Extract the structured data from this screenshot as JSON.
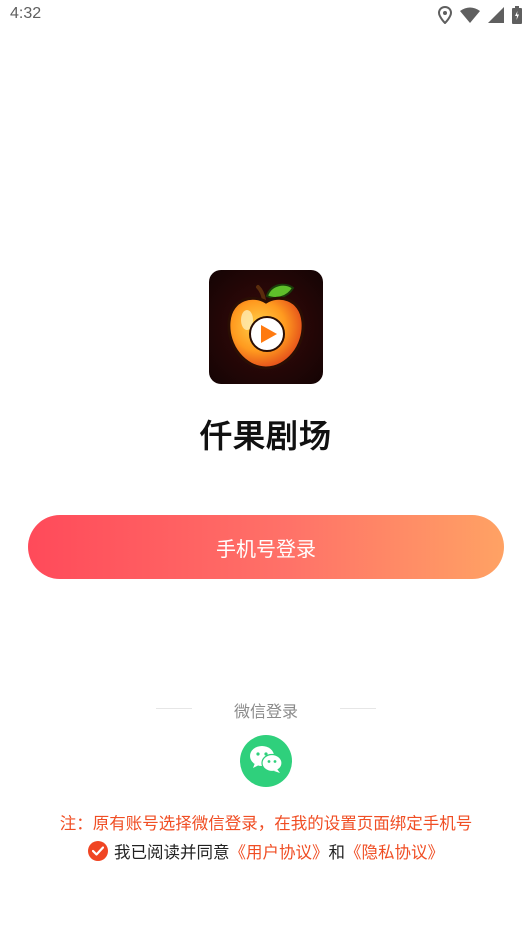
{
  "status_bar": {
    "time": "4:32",
    "icons": [
      "location-icon",
      "wifi-icon",
      "signal-icon",
      "battery-icon"
    ]
  },
  "app": {
    "name": "仟果剧场",
    "logo_icon": "apple-play-logo"
  },
  "login": {
    "phone_button_label": "手机号登录",
    "wechat_label": "微信登录",
    "wechat_icon": "wechat-icon"
  },
  "notice": {
    "text": "注：原有账号选择微信登录，在我的设置页面绑定手机号"
  },
  "agreement": {
    "checked": true,
    "prefix": "我已阅读并同意",
    "user_agreement": "《用户协议》",
    "and": "和",
    "privacy_policy": "《隐私协议》"
  },
  "colors": {
    "accent_start": "#ff4a5a",
    "accent_end": "#ffa264",
    "notice": "#f04e24",
    "wechat": "#2fd07c"
  }
}
